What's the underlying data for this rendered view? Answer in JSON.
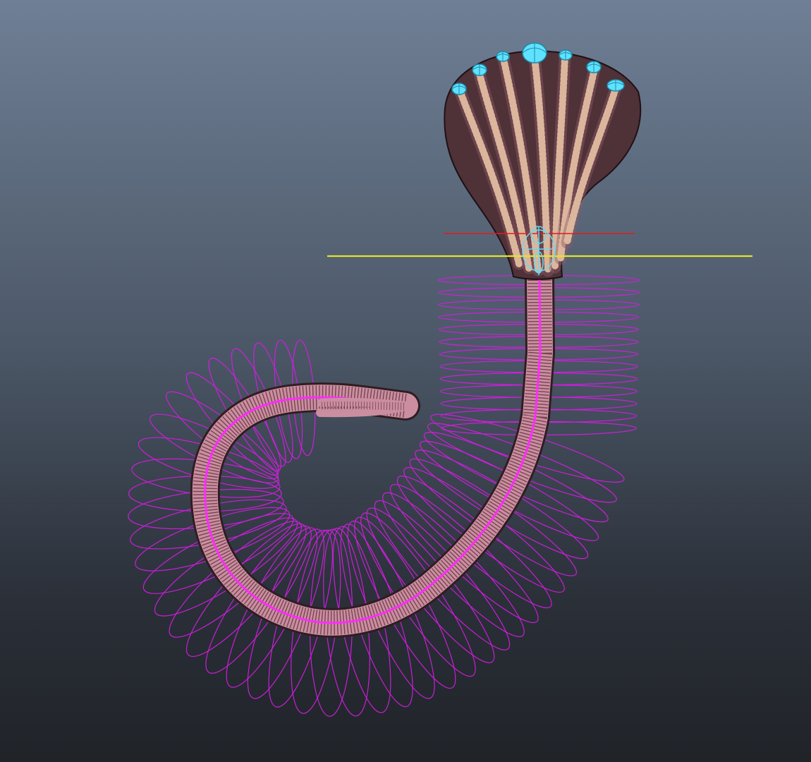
{
  "viewport": {
    "label": "",
    "colors": {
      "background_top": "#6f7f95",
      "background_bottom": "#202328",
      "rig_rings": "#d21de0",
      "controls": "#5fe2ff",
      "axis_x": "#e01d1d",
      "axis_y": "#e2e528",
      "body_mesh": "#cb8ea1",
      "head_ribs": "#e2bda0"
    },
    "icons": {
      "head_controls": "sphere-control-icon",
      "pivot_control": "pivot-locator-icon"
    }
  }
}
